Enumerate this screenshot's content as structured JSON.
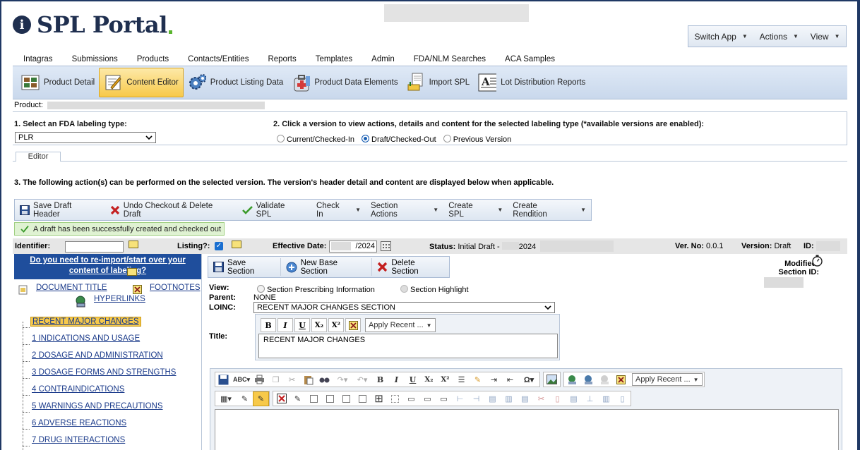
{
  "app": {
    "logo_text": "SPL Portal",
    "logo_glyph": "i"
  },
  "app_menu": [
    {
      "label": "Switch App"
    },
    {
      "label": "Actions"
    },
    {
      "label": "View"
    }
  ],
  "top_nav": [
    "Intagras",
    "Submissions",
    "Products",
    "Contacts/Entities",
    "Reports",
    "Templates",
    "Admin",
    "FDA/NLM Searches",
    "ACA Samples"
  ],
  "toolbar": [
    {
      "label": "Product Detail",
      "icon": "product-detail-icon"
    },
    {
      "label": "Content Editor",
      "icon": "content-editor-icon",
      "active": true
    },
    {
      "label": "Product Listing Data",
      "icon": "gears-icon"
    },
    {
      "label": "Product Data Elements",
      "icon": "medkit-icon"
    },
    {
      "label": "Import SPL",
      "icon": "import-icon"
    },
    {
      "label": "Lot Distribution Reports",
      "icon": "report-icon"
    }
  ],
  "product": {
    "label": "Product:"
  },
  "step1": {
    "label": "1. Select an FDA labeling type:",
    "selected": "PLR"
  },
  "step2": {
    "label": "2. Click a version to view actions, details and content for the selected labeling type (*available versions are enabled):",
    "options": [
      {
        "label": "Current/Checked-In",
        "checked": false
      },
      {
        "label": "Draft/Checked-Out",
        "checked": true
      },
      {
        "label": "Previous Version",
        "checked": false
      }
    ]
  },
  "tab": {
    "label": "Editor"
  },
  "step3": {
    "label": "3. The following action(s) can be performed on the selected version. The version's header detail and content are displayed below when applicable."
  },
  "actions": [
    {
      "label": "Save Draft Header",
      "icon": "save-icon",
      "dropdown": false
    },
    {
      "label": "Undo Checkout & Delete Draft",
      "icon": "delete-x-icon",
      "dropdown": false
    },
    {
      "label": "Validate SPL",
      "icon": "checkmark-icon",
      "dropdown": false
    },
    {
      "label": "Check In",
      "dropdown": true
    },
    {
      "label": "Section Actions",
      "dropdown": true
    },
    {
      "label": "Create SPL",
      "dropdown": true
    },
    {
      "label": "Create Rendition",
      "dropdown": true
    }
  ],
  "success_msg": "A draft has been successfully created and checked out",
  "info": {
    "identifier_label": "Identifier:",
    "listing_label": "Listing?:",
    "effective_label": "Effective Date:",
    "effective_value": "/2024",
    "status_label": "Status:",
    "status_value": "Initial Draft -",
    "status_year": "2024",
    "verno_label": "Ver. No:",
    "verno_value": "0.0.1",
    "version_label": "Version:",
    "version_value": "Draft",
    "id_label": "ID:"
  },
  "tree": {
    "header": "Do you need to re-import/start over your content of labeling?",
    "document_title": "DOCUMENT TITLE",
    "footnotes": "FOOTNOTES",
    "hyperlinks": "HYPERLINKS",
    "items": [
      {
        "label": "RECENT MAJOR CHANGES",
        "selected": true
      },
      {
        "label": "1 INDICATIONS AND USAGE"
      },
      {
        "label": "2 DOSAGE AND ADMINISTRATION"
      },
      {
        "label": "3 DOSAGE FORMS AND STRENGTHS"
      },
      {
        "label": "4 CONTRAINDICATIONS"
      },
      {
        "label": "5 WARNINGS AND PRECAUTIONS"
      },
      {
        "label": "6 ADVERSE REACTIONS"
      },
      {
        "label": "7 DRUG INTERACTIONS"
      }
    ]
  },
  "section_bar": [
    {
      "label": "Save Section",
      "icon": "save-icon"
    },
    {
      "label": "New Base Section",
      "icon": "plus-circle-icon"
    },
    {
      "label": "Delete Section",
      "icon": "delete-x-icon"
    }
  ],
  "modified": {
    "modified_label": "Modified:",
    "section_id_label": "Section ID:"
  },
  "section_form": {
    "view_label": "View:",
    "view_options": [
      {
        "label": "Section Prescribing Information",
        "checked": false
      },
      {
        "label": "Section Highlight",
        "checked": false
      }
    ],
    "parent_label": "Parent:",
    "parent_value": "NONE",
    "loinc_label": "LOINC:",
    "loinc_value": "RECENT MAJOR CHANGES SECTION",
    "title_label": "Title:",
    "title_value": "RECENT MAJOR CHANGES",
    "apply_recent": "Apply Recent ..."
  },
  "editor": {
    "apply_recent": "Apply Recent ..."
  }
}
